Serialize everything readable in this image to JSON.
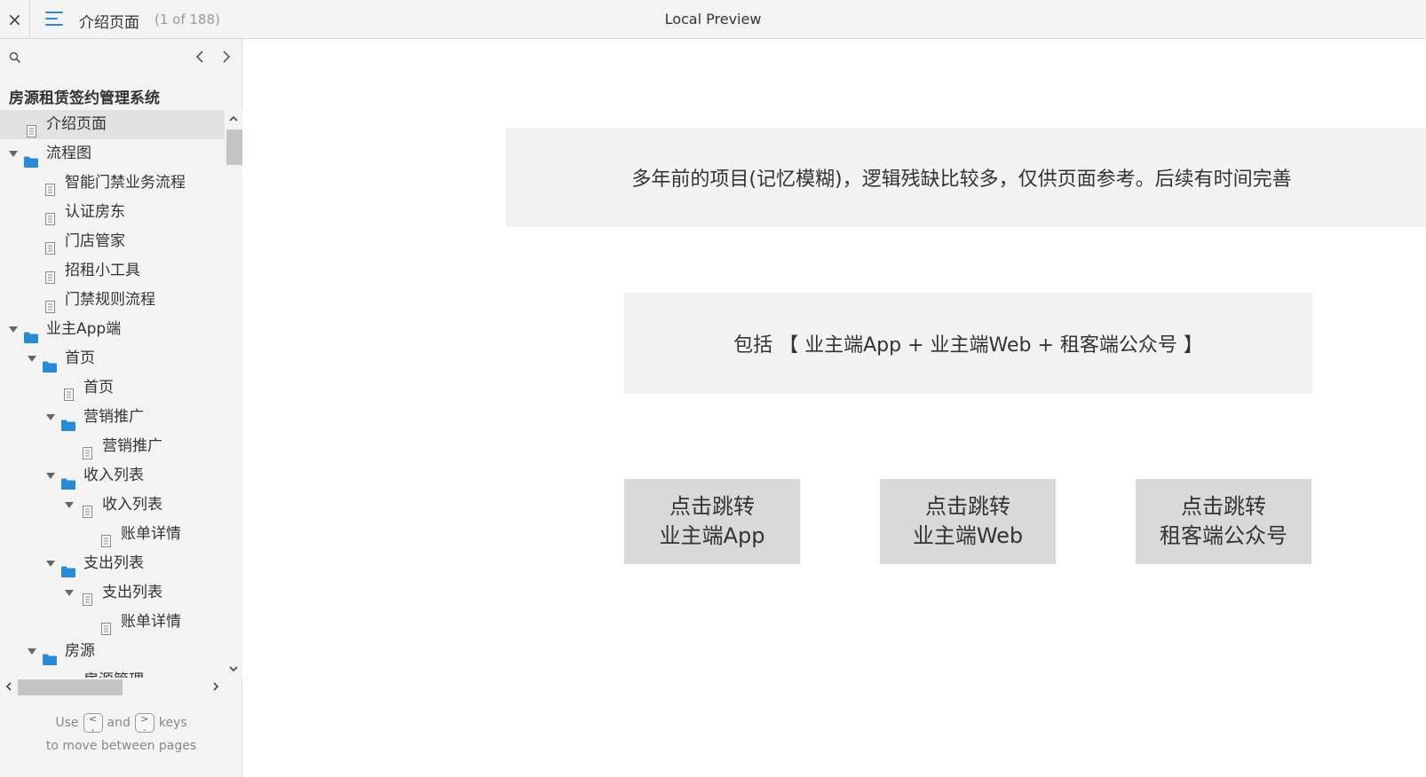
{
  "topbar": {
    "close_label": "×",
    "page_name": "介绍页面",
    "page_count": "(1 of 188)",
    "app_title": "Local Preview"
  },
  "sidebar": {
    "project_title": "房源租赁签约管理系统",
    "tree": [
      {
        "label": "介绍页面",
        "type": "page",
        "level": 0,
        "selected": true
      },
      {
        "label": "流程图",
        "type": "folder",
        "level": 0,
        "expanded": true
      },
      {
        "label": "智能门禁业务流程",
        "type": "page",
        "level": 1
      },
      {
        "label": "认证房东",
        "type": "page",
        "level": 1
      },
      {
        "label": "门店管家",
        "type": "page",
        "level": 1
      },
      {
        "label": "招租小工具",
        "type": "page",
        "level": 1
      },
      {
        "label": "门禁规则流程",
        "type": "page",
        "level": 1
      },
      {
        "label": "业主App端",
        "type": "folder",
        "level": 0,
        "expanded": true
      },
      {
        "label": "首页",
        "type": "folder",
        "level": 1,
        "expanded": true
      },
      {
        "label": "首页",
        "type": "page",
        "level": 2
      },
      {
        "label": "营销推广",
        "type": "folder",
        "level": 2,
        "expanded": true
      },
      {
        "label": "营销推广",
        "type": "page",
        "level": 3
      },
      {
        "label": "收入列表",
        "type": "folder",
        "level": 2,
        "expanded": true
      },
      {
        "label": "收入列表",
        "type": "page",
        "level": 3,
        "expanded": true
      },
      {
        "label": "账单详情",
        "type": "page",
        "level": 4
      },
      {
        "label": "支出列表",
        "type": "folder",
        "level": 2,
        "expanded": true
      },
      {
        "label": "支出列表",
        "type": "page",
        "level": 3,
        "expanded": true
      },
      {
        "label": "账单详情",
        "type": "page",
        "level": 4
      },
      {
        "label": "房源",
        "type": "folder",
        "level": 1,
        "expanded": true
      },
      {
        "label": "房源管理",
        "type": "folder",
        "level": 2
      }
    ],
    "hint": {
      "use": "Use",
      "and": "and",
      "keys": "keys",
      "line2": "to move between pages",
      "key_prev": "<\n,",
      "key_next": ">\n."
    }
  },
  "content": {
    "notice": "多年前的项目(记忆模糊)，逻辑残缺比较多，仅供页面参考。后续有时间完善",
    "include": "包括 【 业主端App + 业主端Web + 租客端公众号 】",
    "buttons": [
      {
        "line1": "点击跳转",
        "line2": "业主端App"
      },
      {
        "line1": "点击跳转",
        "line2": "业主端Web"
      },
      {
        "line1": "点击跳转",
        "line2": "租客端公众号"
      }
    ]
  },
  "colors": {
    "accent": "#2a8ad4",
    "panel_bg": "#f3f3f3",
    "box_bg": "#f2f2f2",
    "button_bg": "#d9d9d9"
  },
  "icons": {
    "close": "close-icon",
    "menu": "hamburger-menu-icon",
    "search": "search-icon",
    "prev": "chevron-left-icon",
    "next": "chevron-right-icon",
    "page": "page-icon",
    "folder": "folder-icon",
    "expand": "triangle-down-icon"
  }
}
